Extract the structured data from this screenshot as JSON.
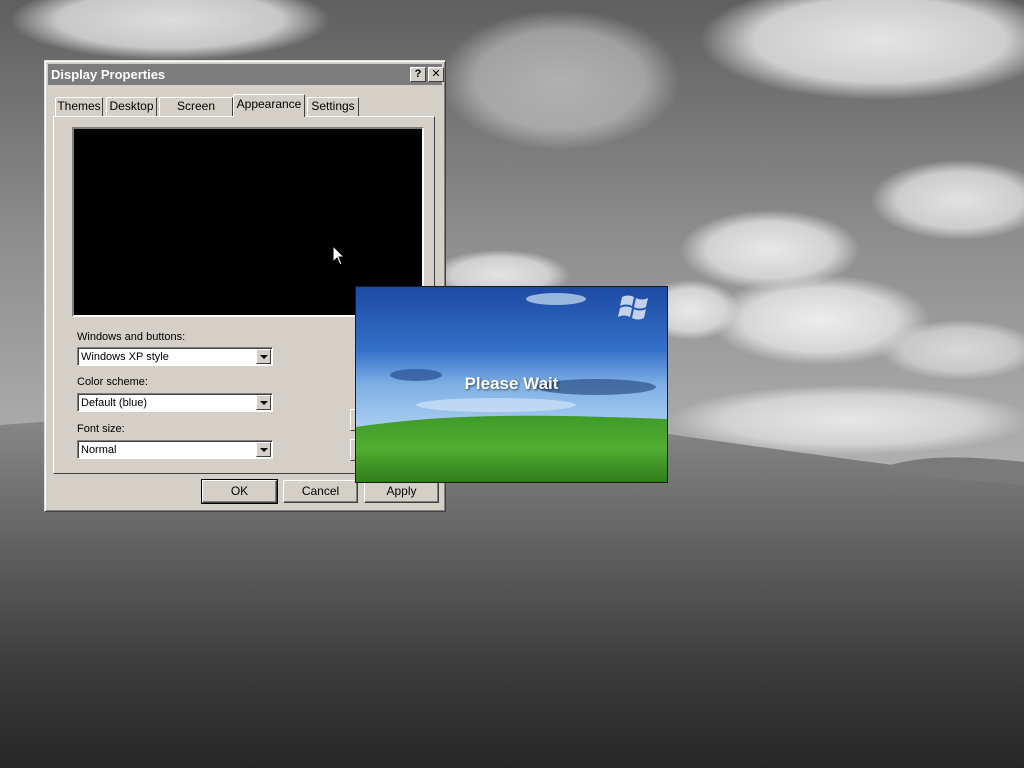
{
  "dialog": {
    "title": "Display Properties",
    "help_button": "?",
    "close_button": "✕",
    "tabs": [
      {
        "label": "Themes"
      },
      {
        "label": "Desktop"
      },
      {
        "label": "Screen Saver"
      },
      {
        "label": "Appearance",
        "selected": true
      },
      {
        "label": "Settings"
      }
    ],
    "fields": {
      "windows_buttons": {
        "label": "Windows and buttons:",
        "value": "Windows XP style"
      },
      "color_scheme": {
        "label": "Color scheme:",
        "value": "Default (blue)"
      },
      "font_size": {
        "label": "Font size:",
        "value": "Normal"
      }
    },
    "buttons": {
      "ok": "OK",
      "cancel": "Cancel",
      "apply": "Apply"
    }
  },
  "splash": {
    "message": "Please Wait",
    "logo_icon": "windows-flag-icon"
  },
  "colors": {
    "dialog_face": "#d4d0c8",
    "titlebar": "#7c7c7c",
    "preview": "#000000"
  }
}
